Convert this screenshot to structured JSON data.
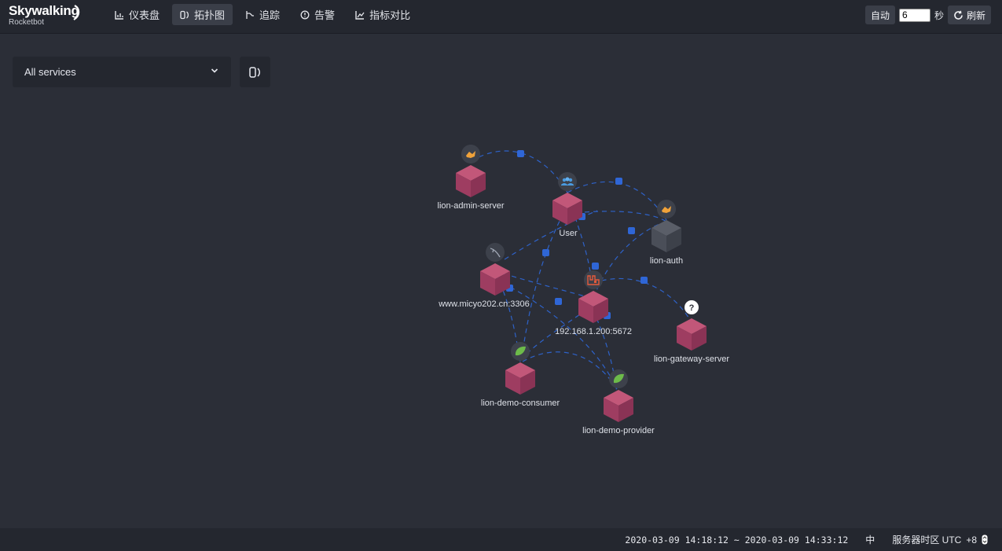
{
  "brand": {
    "title": "Skywalking",
    "subtitle": "Rocketbot"
  },
  "nav": [
    {
      "label": "仪表盘",
      "icon": "chart-icon",
      "active": false
    },
    {
      "label": "拓扑图",
      "icon": "topology-icon",
      "active": true
    },
    {
      "label": "追踪",
      "icon": "trace-icon",
      "active": false
    },
    {
      "label": "告警",
      "icon": "alarm-icon",
      "active": false
    },
    {
      "label": "指标对比",
      "icon": "compare-icon",
      "active": false
    }
  ],
  "controls": {
    "auto_label": "自动",
    "interval_value": "6",
    "unit": "秒",
    "refresh_label": "刷新"
  },
  "filter": {
    "selected": "All services"
  },
  "topology": {
    "nodes": [
      {
        "id": "lion-admin-server",
        "label": "lion-admin-server",
        "icon": "tomcat-icon",
        "color": "#a13f63"
      },
      {
        "id": "User",
        "label": "User",
        "icon": "users-icon",
        "color": "#a13f63"
      },
      {
        "id": "lion-auth",
        "label": "lion-auth",
        "icon": "tomcat-icon",
        "color": "#4b4f59"
      },
      {
        "id": "www.micyo202.cn:3306",
        "label": "www.micyo202.cn:3306",
        "icon": "mysql-icon",
        "color": "#a13f63"
      },
      {
        "id": "192.168.1.200:5672",
        "label": "192.168.1.200:5672",
        "icon": "rabbitmq-icon",
        "color": "#a13f63"
      },
      {
        "id": "lion-gateway-server",
        "label": "lion-gateway-server",
        "icon": "unknown-icon",
        "color": "#a13f63"
      },
      {
        "id": "lion-demo-consumer",
        "label": "lion-demo-consumer",
        "icon": "spring-icon",
        "color": "#a13f63"
      },
      {
        "id": "lion-demo-provider",
        "label": "lion-demo-provider",
        "icon": "spring-icon",
        "color": "#a13f63"
      }
    ]
  },
  "footer": {
    "time_range": "2020-03-09 14:18:12 ~ 2020-03-09 14:33:12",
    "lang": "中",
    "timezone_label": "服务器时区 UTC",
    "timezone_value": "+8"
  }
}
